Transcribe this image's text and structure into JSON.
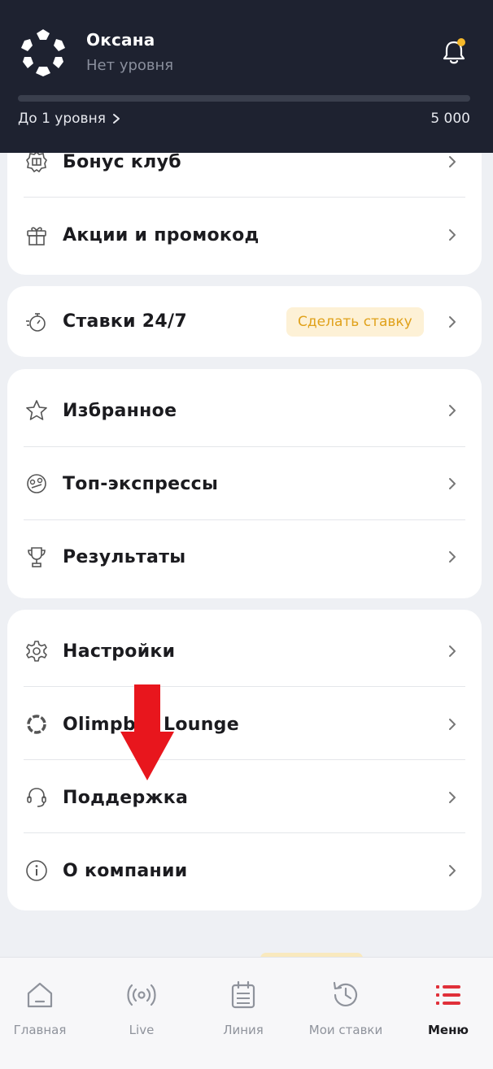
{
  "header": {
    "user_name": "Оксана",
    "user_level": "Нет уровня",
    "level_link": "До 1 уровня",
    "points": "5 000",
    "progress": 0,
    "accent_color": "#f5b82a",
    "notification_icon": "bell-icon"
  },
  "menu": {
    "bonus_club": "Бонус клуб",
    "promotions": "Акции и промокод",
    "bets_247": "Ставки 24/7",
    "make_bet": "Сделать ставку",
    "favorites": "Избранное",
    "top_express": "Топ-экспрессы",
    "results": "Результаты",
    "settings": "Настройки",
    "lounge": "Olimpbet Lounge",
    "support": "Поддержка",
    "about": "О компании"
  },
  "annotation": {
    "arrow_color": "#e8161d"
  },
  "tabbar": {
    "home": "Главная",
    "live": "Live",
    "line": "Линия",
    "my_bets": "Мои ставки",
    "menu": "Меню",
    "active_color": "#e0303a"
  }
}
